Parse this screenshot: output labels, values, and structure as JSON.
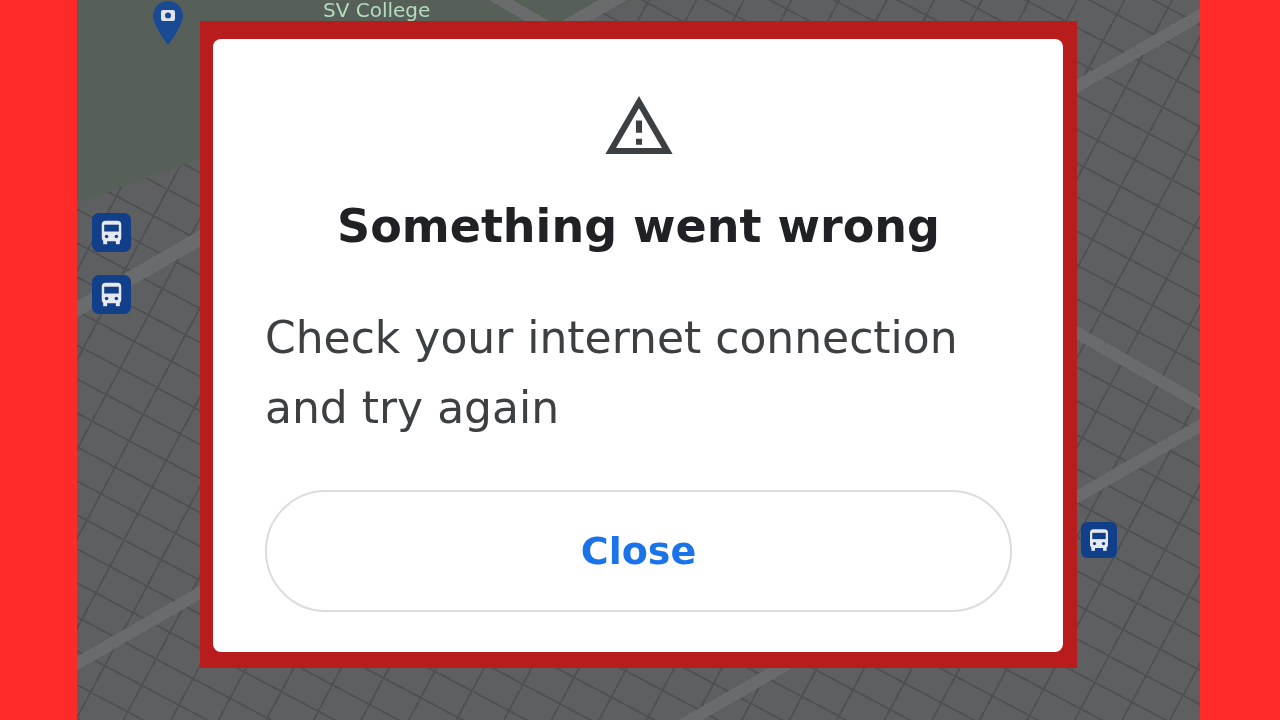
{
  "map": {
    "place_label": "SV College"
  },
  "dialog": {
    "title": "Something went wrong",
    "message": "Check your internet connection and try again",
    "button": {
      "label": "Close"
    }
  }
}
